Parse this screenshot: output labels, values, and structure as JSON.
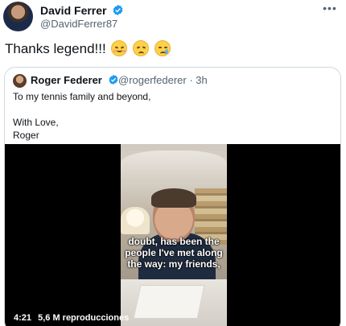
{
  "tweet": {
    "author_name": "David Ferrer",
    "author_handle": "@DavidFerrer87",
    "text": "Thanks legend!!!",
    "more_icon": "more-horizontal-icon",
    "emojis": [
      "relieved-face-emoji",
      "sad-face-emoji",
      "crying-face-emoji"
    ]
  },
  "quoted": {
    "author_name": "Roger Federer",
    "author_handle": "@rogerfederer · 3h",
    "lines": [
      "To my tennis family and beyond,",
      "",
      "With Love,",
      "Roger"
    ],
    "video": {
      "caption_lines": [
        "doubt, has been the",
        "people I've met along",
        "the way: my friends,"
      ],
      "duration": "4:21",
      "views": "5,6 M reproducciones"
    }
  },
  "colors": {
    "text": "#0f1419",
    "secondary": "#536471",
    "verified": "#1d9bf0",
    "border": "#cfd9de"
  }
}
